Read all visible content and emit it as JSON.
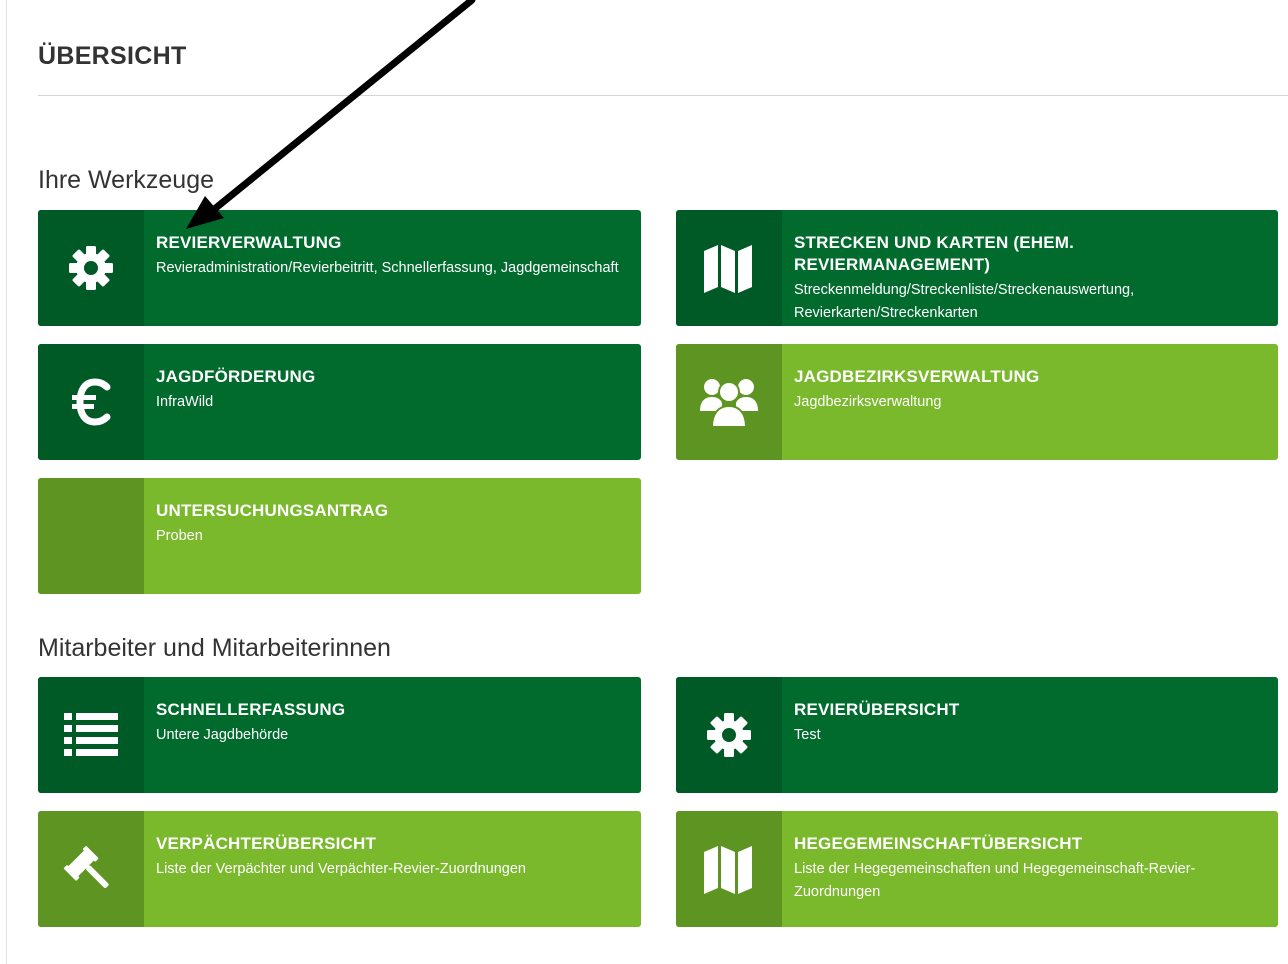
{
  "page": {
    "title": "ÜBERSICHT"
  },
  "sections": [
    {
      "heading": "Ihre Werkzeuge",
      "tiles": [
        {
          "title": "REVIERVERWALTUNG",
          "description": "Revieradministration/Revierbeitritt, Schnellerfassung, Jagdgemeinschaft",
          "icon": "gear-icon",
          "variant": "dark"
        },
        {
          "title": "STRECKEN UND KARTEN (EHEM. REVIERMANAGEMENT)",
          "description": "Streckenmeldung/Streckenliste/Streckenauswertung, Revierkarten/Streckenkarten",
          "icon": "map-icon",
          "variant": "dark"
        },
        {
          "title": "JAGDFÖRDERUNG",
          "description": "InfraWild",
          "icon": "euro-icon",
          "variant": "dark"
        },
        {
          "title": "JAGDBEZIRKSVERWALTUNG",
          "description": "Jagdbezirksverwaltung",
          "icon": "users-icon",
          "variant": "light"
        },
        {
          "title": "UNTERSUCHUNGSANTRAG",
          "description": "Proben",
          "icon": "",
          "variant": "light"
        }
      ]
    },
    {
      "heading": "Mitarbeiter und Mitarbeiterinnen",
      "tiles": [
        {
          "title": "SCHNELLERFASSUNG",
          "description": "Untere Jagdbehörde",
          "icon": "list-icon",
          "variant": "dark"
        },
        {
          "title": "REVIERÜBERSICHT",
          "description": "Test",
          "icon": "gear-icon",
          "variant": "dark"
        },
        {
          "title": "VERPÄCHTERÜBERSICHT",
          "description": "Liste der Verpächter und Verpächter-Revier-Zuordnungen",
          "icon": "gavel-icon",
          "variant": "light"
        },
        {
          "title": "HEGEGEMEINSCHAFTÜBERSICHT",
          "description": "Liste der Hegegemeinschaften und Hegegemeinschaft-Revier-Zuordnungen",
          "icon": "map-icon",
          "variant": "light"
        }
      ]
    }
  ],
  "colors": {
    "dark_tile": "#006b2d",
    "dark_tile_icon": "#005a25",
    "light_tile": "#7ab82c",
    "light_tile_icon": "#5e9422",
    "annotation_arrow": "#000000"
  }
}
